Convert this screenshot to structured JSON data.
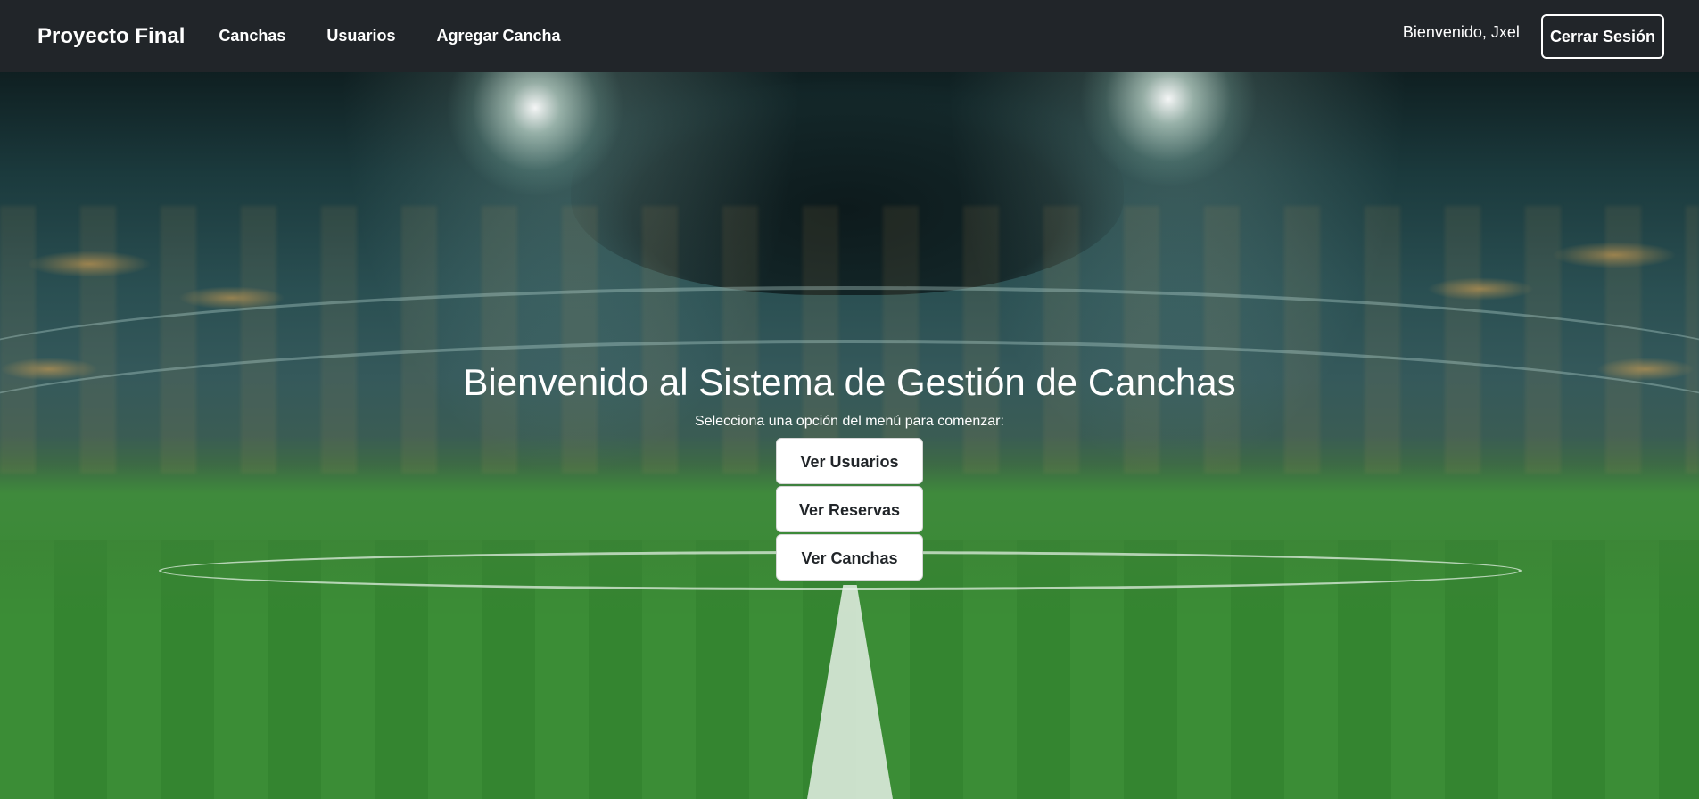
{
  "navbar": {
    "brand": "Proyecto Final",
    "links": [
      {
        "label": "Canchas"
      },
      {
        "label": "Usuarios"
      },
      {
        "label": "Agregar Cancha"
      }
    ],
    "welcome_text": "Bienvenido, Jxel",
    "logout_label": "Cerrar Sesión"
  },
  "hero": {
    "title": "Bienvenido al Sistema de Gestión de Canchas",
    "subtitle": "Selecciona una opción del menú para comenzar:",
    "background": "football-stadium-image",
    "buttons": [
      {
        "label": "Ver Usuarios"
      },
      {
        "label": "Ver Reservas"
      },
      {
        "label": "Ver Canchas"
      }
    ]
  },
  "colors": {
    "navbar_bg": "#212529",
    "button_bg": "#ffffff",
    "button_text": "#212529",
    "text_light": "#ffffff"
  }
}
